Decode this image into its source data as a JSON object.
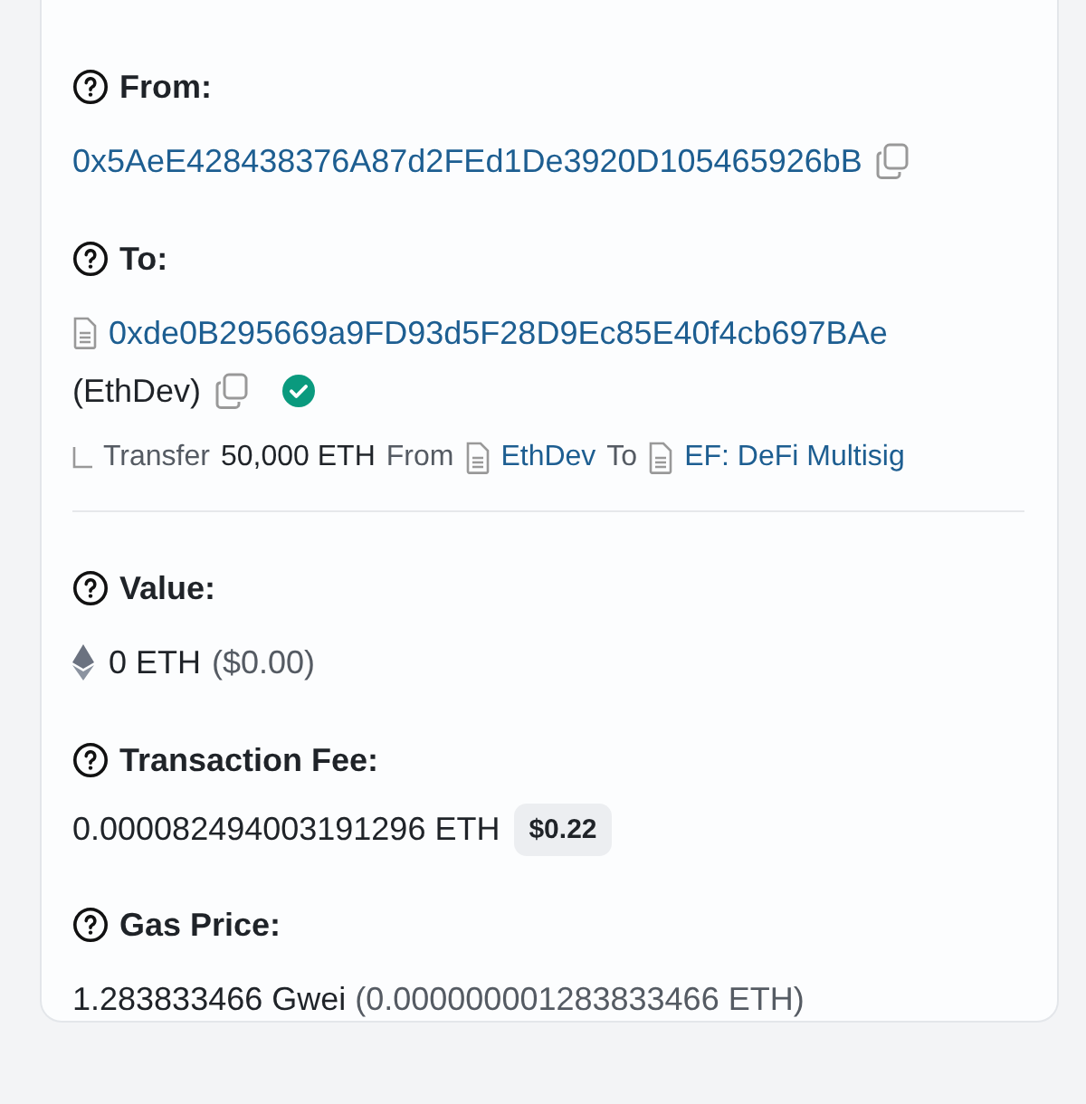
{
  "from": {
    "label": "From:",
    "address": "0x5AeE428438376A87d2FEd1De3920D105465926bB"
  },
  "to": {
    "label": "To:",
    "address": "0xde0B295669a9FD93d5F28D9Ec85E40f4cb697BAe",
    "name": "(EthDev)",
    "verified": true
  },
  "transfer": {
    "verb": "Transfer",
    "amount": "50,000 ETH",
    "from_word": "From",
    "from": "EthDev",
    "to_word": "To",
    "to": "EF: DeFi Multisig"
  },
  "value": {
    "label": "Value:",
    "amount": "0 ETH",
    "usd": "($0.00)"
  },
  "fee": {
    "label": "Transaction Fee:",
    "amount": "0.000082494003191296 ETH",
    "usd": "$0.22"
  },
  "gas_price": {
    "label": "Gas Price:",
    "gwei": "1.283833466 Gwei",
    "eth": "(0.000000001283833466 ETH)"
  }
}
